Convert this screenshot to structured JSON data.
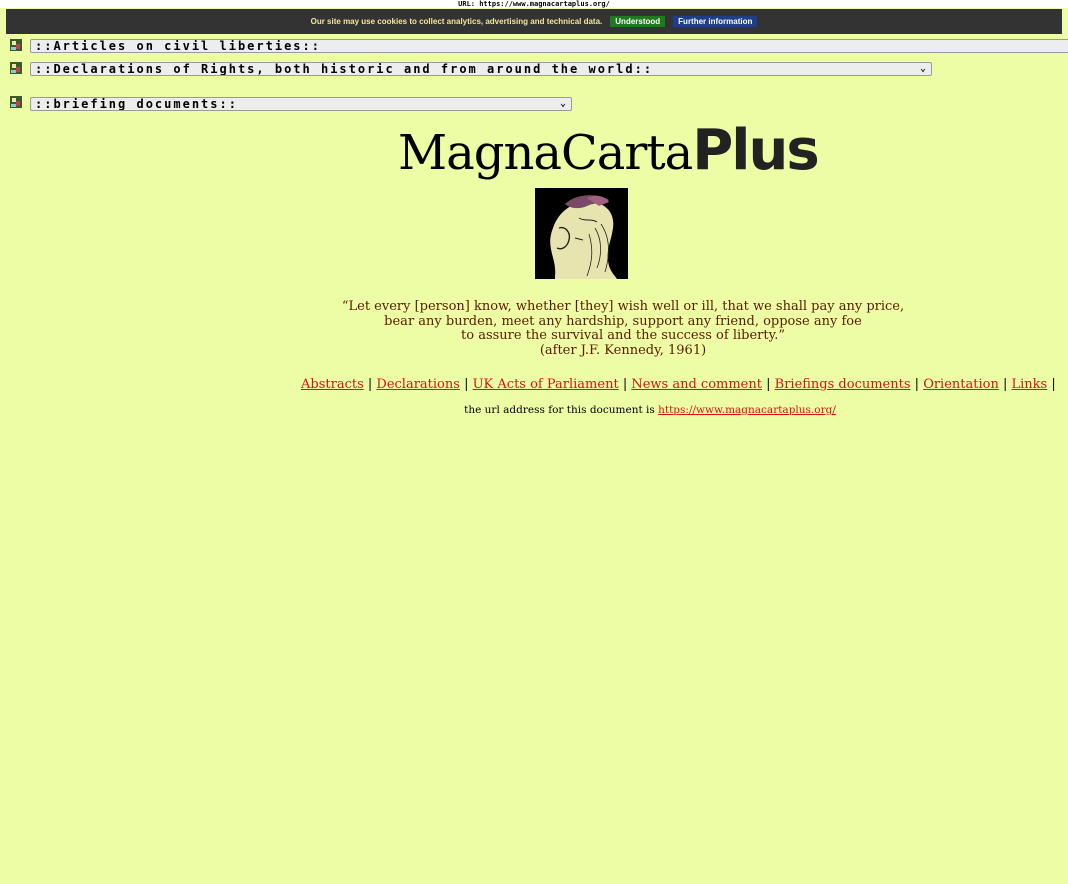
{
  "top_url": "URL: https://www.magnacartaplus.org/",
  "cookie_banner": {
    "message": "Our site may use cookies to collect analytics, advertising and technical data.",
    "understood_label": "Understood",
    "info_label": "Further information"
  },
  "menus": [
    {
      "label": "::Articles on civil liberties::"
    },
    {
      "label": "::Declarations of Rights, both historic and from around the world::"
    },
    {
      "label": "::briefing documents::"
    }
  ],
  "logo": {
    "part1": "MagnaCarta",
    "part2": "Plus"
  },
  "quote": {
    "line1": "“Let every [person] know, whether [they] wish well or ill, that we shall pay any price,",
    "line2": "bear any burden, meet any hardship, support any friend, oppose any foe",
    "line3": "to assure the survival and the success of liberty.”",
    "attribution": "(after J.F. Kennedy, 1961)"
  },
  "nav": [
    {
      "label": "Abstracts"
    },
    {
      "label": "Declarations"
    },
    {
      "label": "UK Acts of Parliament"
    },
    {
      "label": "News and comment"
    },
    {
      "label": "Briefings documents"
    },
    {
      "label": "Orientation"
    },
    {
      "label": "Links"
    }
  ],
  "url_line": {
    "prefix": "the url address for this document is",
    "link": "https://www.magnacartaplus.org/"
  },
  "colors": {
    "background": "#ecfda6",
    "link": "#dd1111",
    "quote_text": "#5a1a00"
  }
}
